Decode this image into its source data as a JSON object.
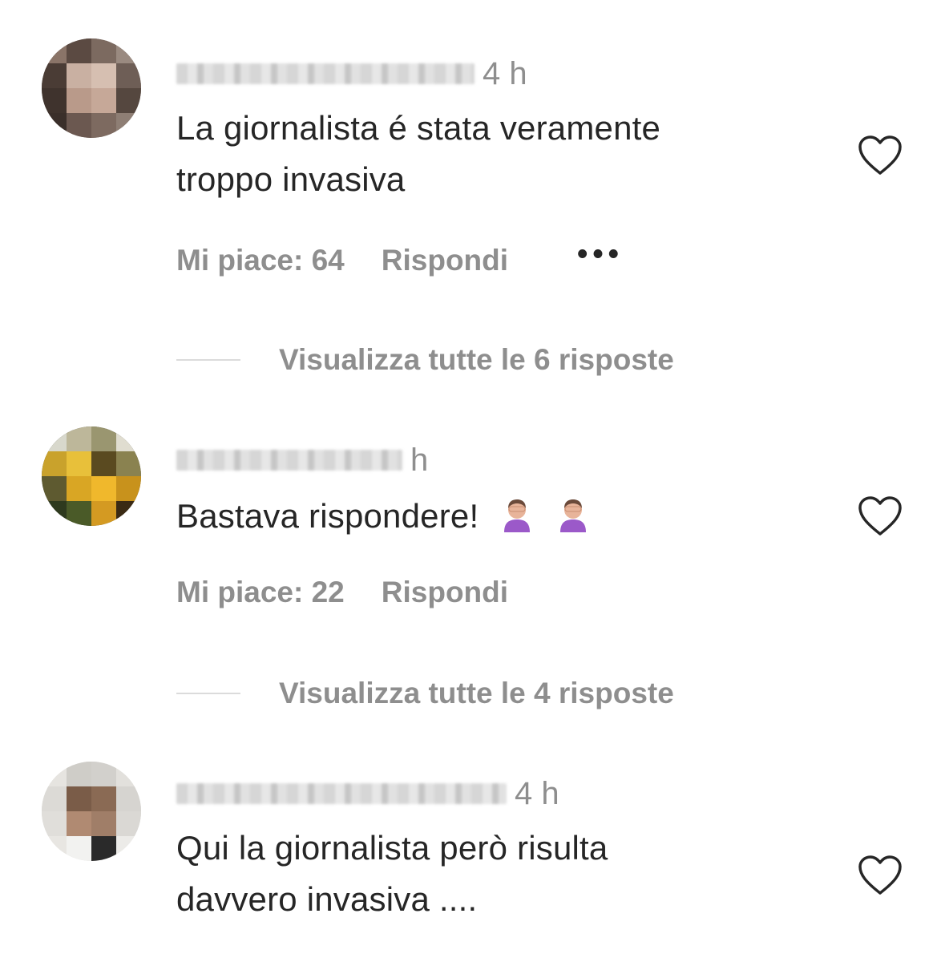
{
  "comments": [
    {
      "time": "4 h",
      "text_line1": "La giornalista é stata veramente",
      "text_line2": "troppo invasiva",
      "likes_label": "Mi piace: 64",
      "reply_label": "Rispondi",
      "more_label": "•••",
      "view_replies_label": "Visualizza tutte le 6 risposte"
    },
    {
      "time": "h",
      "text_line1": "Bastava rispondere!",
      "emojis": [
        "woman-facepalming-icon",
        "woman-facepalming-icon"
      ],
      "likes_label": "Mi piace: 22",
      "reply_label": "Rispondi",
      "view_replies_label": "Visualizza tutte le 4 risposte"
    },
    {
      "time": "4 h",
      "text_line1": "Qui la giornalista però risulta",
      "text_line2": "davvero invasiva ...."
    }
  ],
  "icons": {
    "like": "heart-outline-icon",
    "more": "more-options-icon"
  },
  "colors": {
    "text_primary": "#262626",
    "text_secondary": "#8e8e8e",
    "divider": "#dbdbdb"
  }
}
